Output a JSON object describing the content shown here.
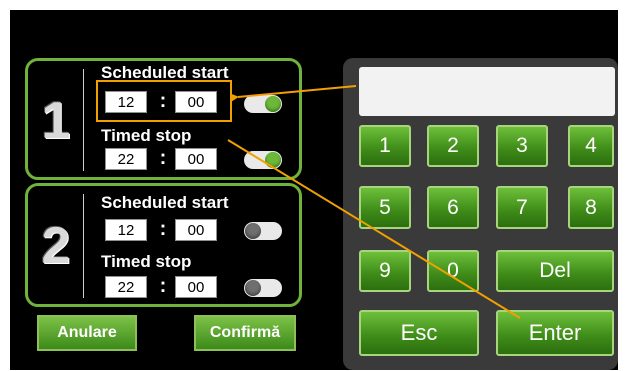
{
  "groups": [
    {
      "number": "1",
      "start_label": "Scheduled start",
      "start_hour": "12",
      "start_minute": "00",
      "start_enabled": true,
      "stop_label": "Timed stop",
      "stop_hour": "22",
      "stop_minute": "00",
      "stop_enabled": true
    },
    {
      "number": "2",
      "start_label": "Scheduled start",
      "start_hour": "12",
      "start_minute": "00",
      "start_enabled": false,
      "stop_label": "Timed stop",
      "stop_hour": "22",
      "stop_minute": "00",
      "stop_enabled": false
    }
  ],
  "time_separator": ":",
  "buttons": {
    "cancel": "Anulare",
    "confirm": "Confirmă"
  },
  "keypad": {
    "display_value": "",
    "keys": [
      "1",
      "2",
      "3",
      "4",
      "5",
      "6",
      "7",
      "8",
      "9",
      "0",
      "Del",
      "Esc",
      "Enter"
    ]
  },
  "colors": {
    "accent_green": "#6fb33a",
    "highlight_orange": "#f0a000",
    "keypad_bg": "#3a3a3a"
  }
}
